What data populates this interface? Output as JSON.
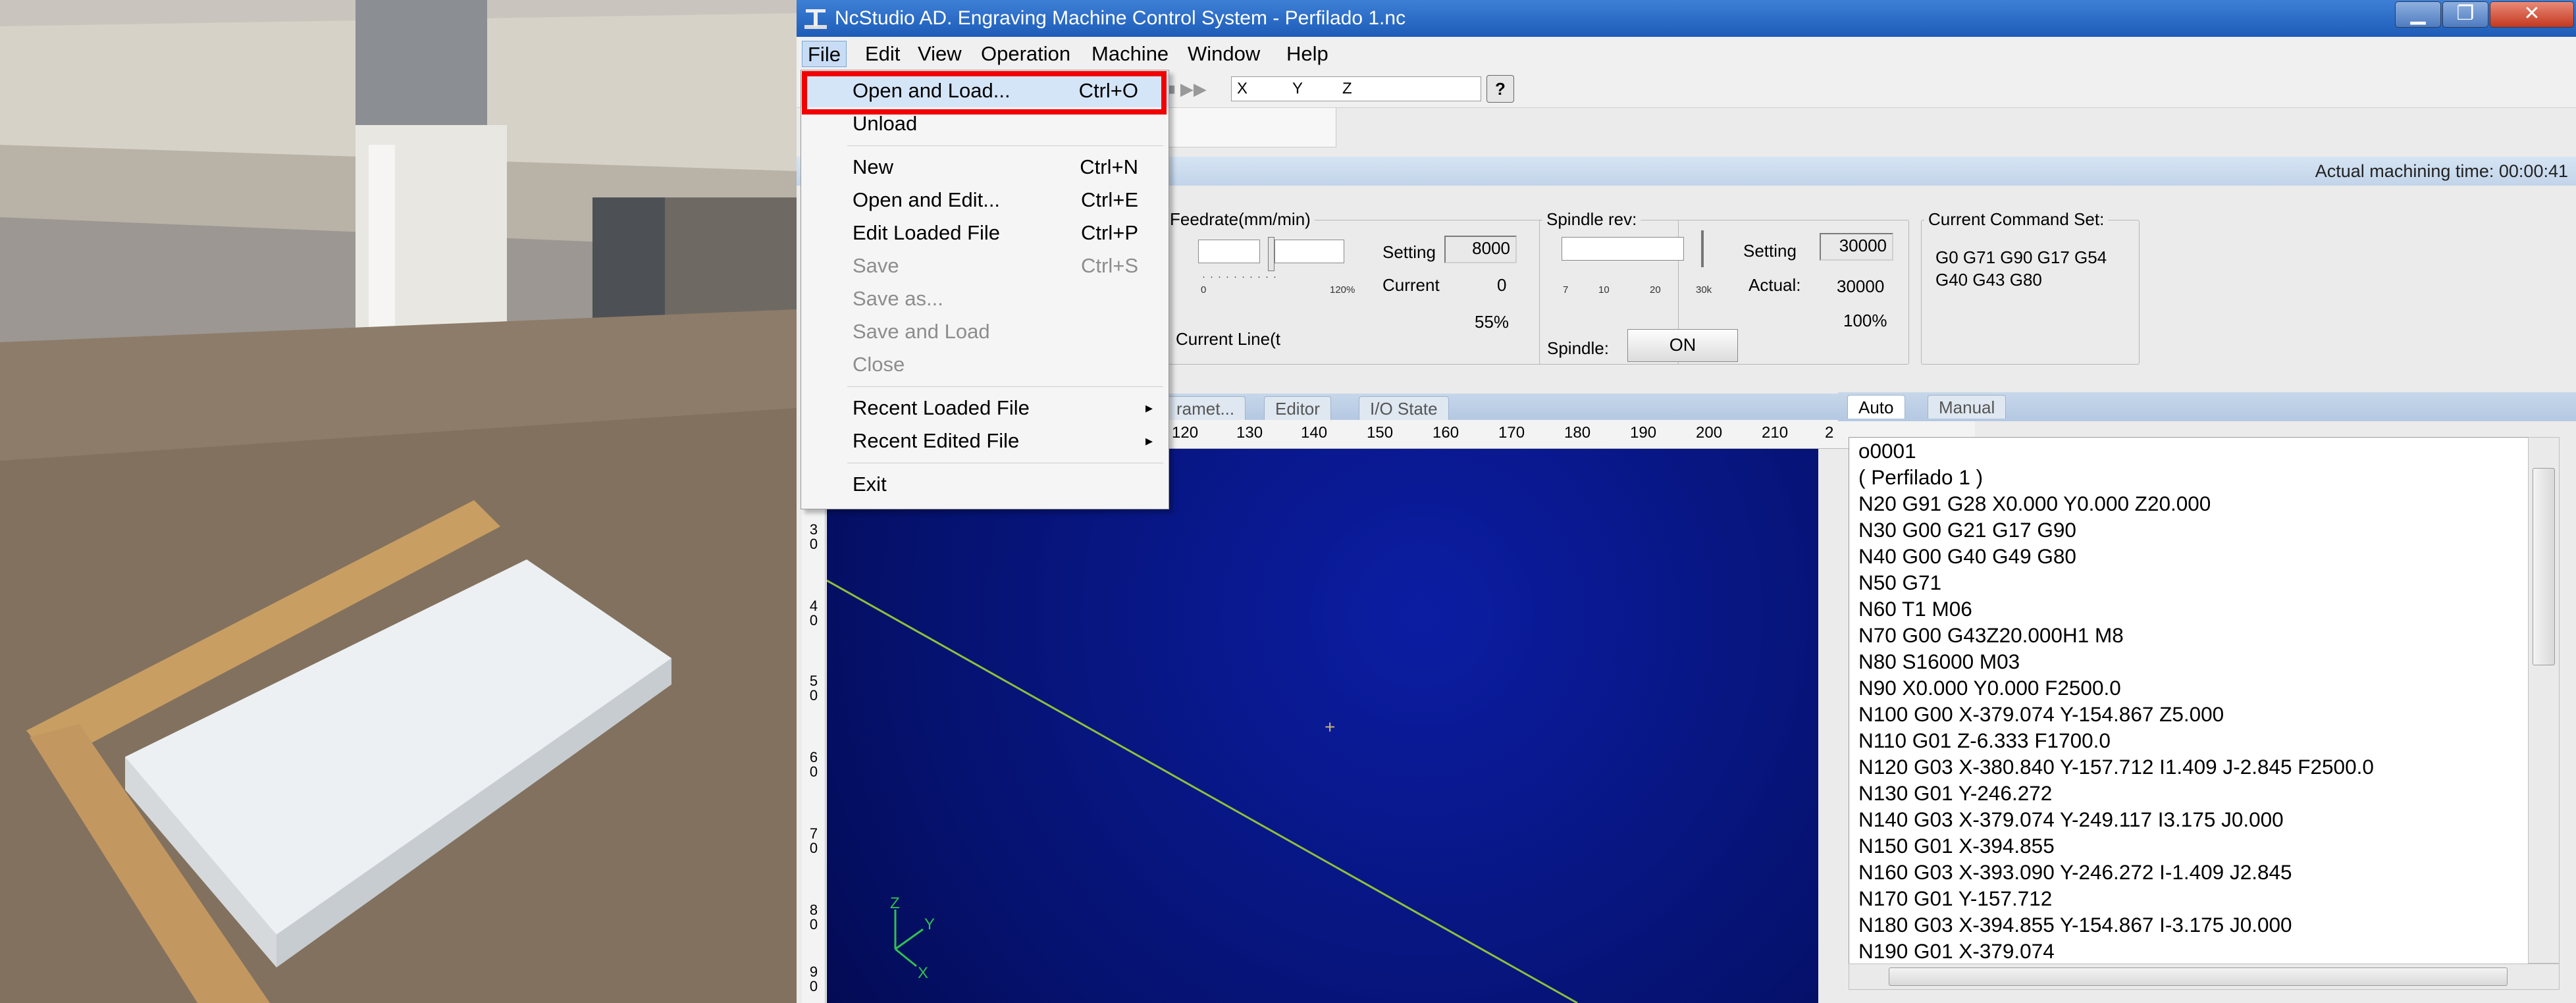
{
  "window": {
    "title": "NcStudio AD. Engraving Machine Control System  - Perfilado 1.nc",
    "minimize_glyph": "▁",
    "maximize_glyph": "❐",
    "close_glyph": "✕"
  },
  "menubar": {
    "items": [
      "File",
      "Edit",
      "View",
      "Operation",
      "Machine",
      "Window",
      "Help"
    ]
  },
  "toolbar": {
    "coord_x": "X",
    "coord_y": "Y",
    "coord_z": "Z",
    "help_glyph": "?",
    "arrows": "■ ▶▶"
  },
  "status": {
    "machining_time": "Actual machining time: 00:00:41"
  },
  "feedrate": {
    "title": "Feedrate(mm/min)",
    "setting_label": "Setting",
    "setting_value": "8000",
    "current_label": "Current",
    "current_value": "0",
    "percent": "55%",
    "tick_min": "0",
    "tick_max": "120%",
    "current_line_label": "Current Line(t"
  },
  "spindle": {
    "title": "Spindle rev:",
    "setting_label": "Setting",
    "setting_value": "30000",
    "actual_label": "Actual:",
    "actual_value": "30000",
    "percent": "100%",
    "ticks": [
      "7",
      "10",
      "20",
      "30k"
    ],
    "spindle_label": "Spindle:",
    "on_button": "ON"
  },
  "command_set": {
    "title": "Current Command Set:",
    "line1": "G0 G71 G90 G17 G54",
    "line2": "G40 G43 G80"
  },
  "left_tabs": [
    "ramet...",
    "Editor",
    "I/O State"
  ],
  "ruler": {
    "marks": [
      "120",
      "130",
      "140",
      "150",
      "160",
      "170",
      "180",
      "190",
      "200",
      "210",
      "2"
    ],
    "v_marks": [
      "3\n0",
      "4\n0",
      "5\n0",
      "6\n0",
      "7\n0",
      "8\n0",
      "9\n0"
    ]
  },
  "canvas": {
    "axis_z": "Z",
    "axis_y": "Y",
    "axis_x": "X",
    "crosshair": "+"
  },
  "right_tabs": [
    "Auto",
    "Manual"
  ],
  "gcode": [
    "o0001",
    "( Perfilado 1 )",
    "N20 G91 G28 X0.000 Y0.000 Z20.000",
    "N30 G00 G21 G17 G90",
    "N40 G00 G40 G49 G80",
    "N50 G71",
    "N60 T1 M06",
    "N70 G00 G43Z20.000H1 M8",
    "N80 S16000 M03",
    "N90 X0.000 Y0.000 F2500.0",
    "N100 G00 X-379.074 Y-154.867 Z5.000",
    "N110 G01   Z-6.333 F1700.0",
    "N120 G03 X-380.840 Y-157.712 I1.409 J-2.845 F2500.0",
    "N130 G01  Y-246.272",
    "N140 G03 X-379.074 Y-249.117 I3.175 J0.000",
    "N150 G01 X-394.855",
    "N160 G03 X-393.090 Y-246.272 I-1.409 J2.845",
    "N170 G01  Y-157.712",
    "N180 G03 X-394.855 Y-154.867 I-3.175 J0.000",
    "N190 G01 X-379.074"
  ],
  "file_menu": {
    "items": [
      {
        "label": "Open and Load...",
        "shortcut": "Ctrl+O",
        "enabled": true,
        "highlight": true
      },
      {
        "label": "Unload",
        "shortcut": "",
        "enabled": true
      },
      {
        "label": "New",
        "shortcut": "Ctrl+N",
        "enabled": true
      },
      {
        "label": "Open and Edit...",
        "shortcut": "Ctrl+E",
        "enabled": true
      },
      {
        "label": "Edit Loaded File",
        "shortcut": "Ctrl+P",
        "enabled": true
      },
      {
        "label": "Save",
        "shortcut": "Ctrl+S",
        "enabled": false
      },
      {
        "label": "Save as...",
        "shortcut": "",
        "enabled": false
      },
      {
        "label": "Save and Load",
        "shortcut": "",
        "enabled": false
      },
      {
        "label": "Close",
        "shortcut": "",
        "enabled": false
      },
      {
        "label": "Recent Loaded File",
        "shortcut": "",
        "enabled": true,
        "submenu": true
      },
      {
        "label": "Recent Edited File",
        "shortcut": "",
        "enabled": true,
        "submenu": true
      },
      {
        "label": "Exit",
        "shortcut": "",
        "enabled": true
      }
    ],
    "submenu_glyph": "▸"
  },
  "colors": {
    "canvas_bg": "#05126f",
    "toolpath": "#8fbf3a",
    "highlight_box": "#f20000",
    "titlebar": "#1c5cb8"
  }
}
